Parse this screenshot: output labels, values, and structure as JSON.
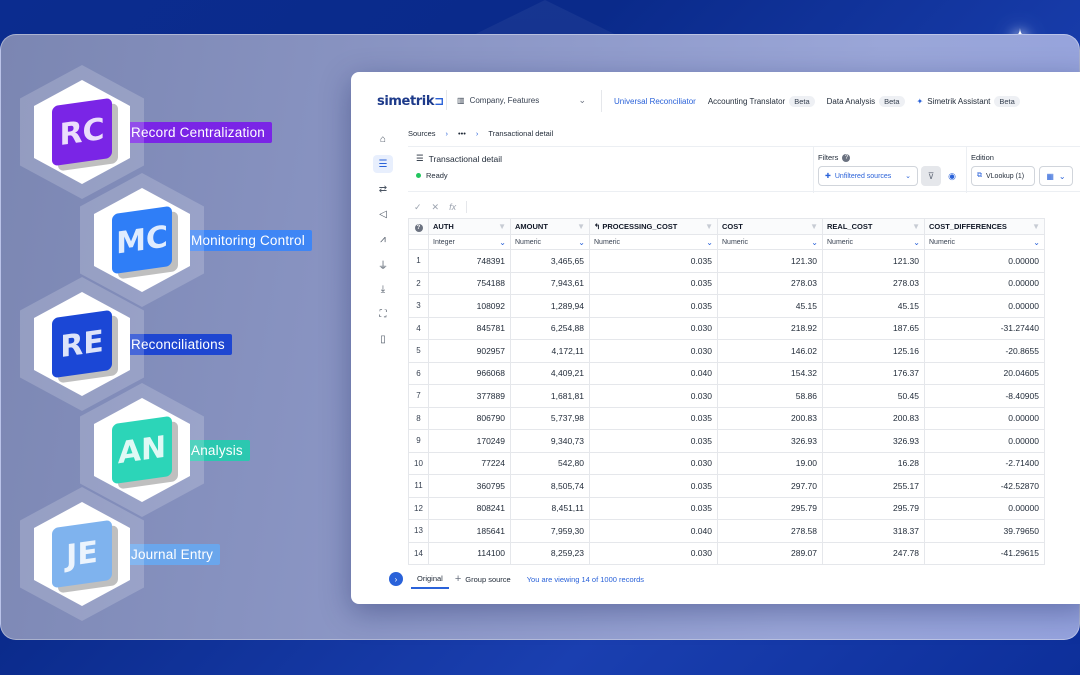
{
  "features": [
    {
      "label": "Record Centralization",
      "glyph": "RC",
      "icon": "record-centralization-cube",
      "color": "#7a25e6",
      "tag_color": "#7a25e6"
    },
    {
      "label": "Monitoring Control",
      "glyph": "MC",
      "icon": "monitoring-control-cube",
      "color": "#2f7ef7",
      "tag_color": "#3f86f5"
    },
    {
      "label": "Reconciliations",
      "glyph": "RE",
      "icon": "reconciliations-cube",
      "color": "#1b47d6",
      "tag_color": "#1e46d1"
    },
    {
      "label": "Analysis",
      "glyph": "AN",
      "icon": "analysis-cube",
      "color": "#2cd5b8",
      "tag_color": "#2bc8b0"
    },
    {
      "label": "Journal Entry",
      "glyph": "JE",
      "icon": "journal-entry-cube",
      "color": "#7fb3ee",
      "tag_color": "#6aa6ec"
    }
  ],
  "app": {
    "logo": "simetrik",
    "company": "Company, Features",
    "nav": [
      {
        "label": "Universal Reconciliator",
        "beta": "",
        "active": true
      },
      {
        "label": "Accounting Translator",
        "beta": "Beta"
      },
      {
        "label": "Data Analysis",
        "beta": "Beta"
      },
      {
        "label": "Simetrik Assistant",
        "beta": "Beta"
      }
    ],
    "breadcrumb": {
      "root": "Sources",
      "middle": "•••",
      "current": "Transactional detail"
    },
    "title": "Transactional detail",
    "status": "Ready",
    "filters_label": "Filters",
    "unfiltered_sources": "Unfiltered sources",
    "edition_label": "Edition",
    "vlookup": "VLookup (1)",
    "footer": {
      "tab_original": "Original",
      "tab_group": "Group source",
      "viewing": "You are viewing 14 of 1000 records"
    }
  },
  "table": {
    "columns": [
      {
        "name": "AUTH",
        "type": "Integer"
      },
      {
        "name": "AMOUNT",
        "type": "Numeric"
      },
      {
        "name": "PROCESSING_COST",
        "type": "Numeric"
      },
      {
        "name": "COST",
        "type": "Numeric"
      },
      {
        "name": "REAL_COST",
        "type": "Numeric"
      },
      {
        "name": "COST_DIFFERENCES",
        "type": "Numeric"
      }
    ],
    "rows": [
      [
        "1",
        "748391",
        "3,465,65",
        "0.035",
        "121.30",
        "121.30",
        "0.00000"
      ],
      [
        "2",
        "754188",
        "7,943,61",
        "0.035",
        "278.03",
        "278.03",
        "0.00000"
      ],
      [
        "3",
        "108092",
        "1,289,94",
        "0.035",
        "45.15",
        "45.15",
        "0.00000"
      ],
      [
        "4",
        "845781",
        "6,254,88",
        "0.030",
        "218.92",
        "187.65",
        "-31.27440"
      ],
      [
        "5",
        "902957",
        "4,172,11",
        "0.030",
        "146.02",
        "125.16",
        "-20.8655"
      ],
      [
        "6",
        "966068",
        "4,409,21",
        "0.040",
        "154.32",
        "176.37",
        "20.04605"
      ],
      [
        "7",
        "377889",
        "1,681,81",
        "0.030",
        "58.86",
        "50.45",
        "-8.40905"
      ],
      [
        "8",
        "806790",
        "5,737,98",
        "0.035",
        "200.83",
        "200.83",
        "0.00000"
      ],
      [
        "9",
        "170249",
        "9,340,73",
        "0.035",
        "326.93",
        "326.93",
        "0.00000"
      ],
      [
        "10",
        "77224",
        "542,80",
        "0.030",
        "19.00",
        "16.28",
        "-2.71400"
      ],
      [
        "11",
        "360795",
        "8,505,74",
        "0.035",
        "297.70",
        "255.17",
        "-42.52870"
      ],
      [
        "12",
        "808241",
        "8,451,11",
        "0.035",
        "295.79",
        "295.79",
        "0.00000"
      ],
      [
        "13",
        "185641",
        "7,959,30",
        "0.040",
        "278.58",
        "318.37",
        "39.79650"
      ],
      [
        "14",
        "114100",
        "8,259,23",
        "0.030",
        "289.07",
        "247.78",
        "-41.29615"
      ]
    ]
  }
}
